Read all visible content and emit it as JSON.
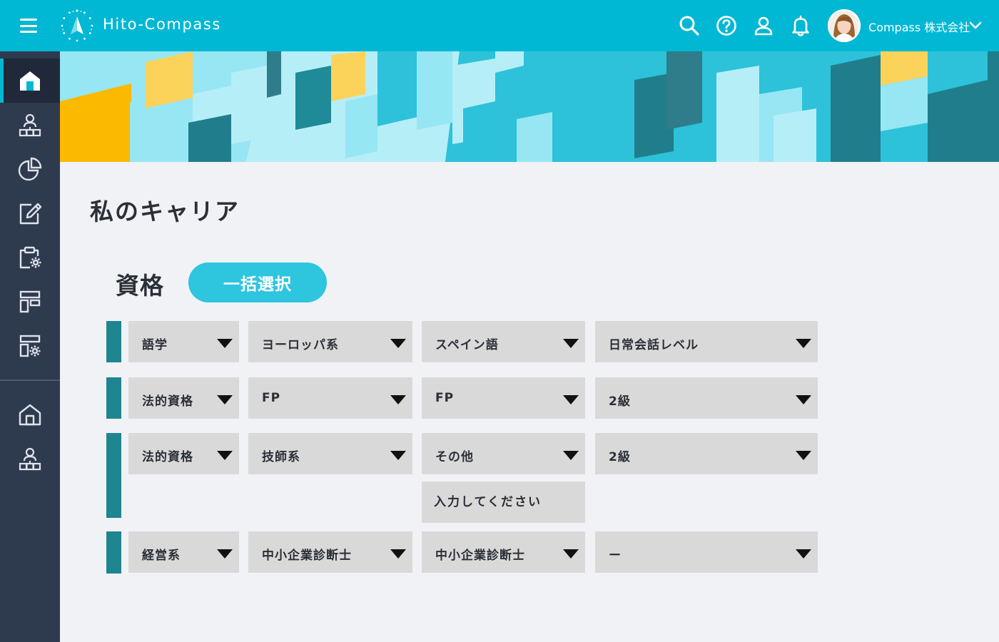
{
  "header": {
    "app_name": "Hito-Compass",
    "company": "Compass 株式会社"
  },
  "page": {
    "title": "私のキャリア"
  },
  "section": {
    "title": "資格",
    "bulk_select_label": "一括選択"
  },
  "qualifications": [
    {
      "category": "語学",
      "group": "ヨーロッパ系",
      "name": "スペイン語",
      "level": "日常会話レベル"
    },
    {
      "category": "法的資格",
      "group": "FP",
      "name": "FP",
      "level": "2級"
    },
    {
      "category": "法的資格",
      "group": "技師系",
      "name": "その他",
      "level": "2級",
      "other_placeholder": "入力してください"
    },
    {
      "category": "経営系",
      "group": "中小企業診断士",
      "name": "中小企業診断士",
      "level": "ー"
    }
  ],
  "colors": {
    "header_bg": "#00b8d4",
    "sidebar_bg": "#2e3a4e",
    "accent": "#2ec5df",
    "row_marker": "#1f8591",
    "dropdown_bg": "#d9d9d9"
  },
  "icons": {
    "header": [
      "menu-icon",
      "compass-logo-icon",
      "search-icon",
      "help-icon",
      "user-icon",
      "bell-icon",
      "chevron-down-icon"
    ],
    "sidebar": [
      "home-icon",
      "org-chart-icon",
      "pie-chart-icon",
      "edit-icon",
      "clipboard-settings-icon",
      "layout-icon",
      "layout-settings-icon",
      "building-icon",
      "team-icon"
    ]
  }
}
